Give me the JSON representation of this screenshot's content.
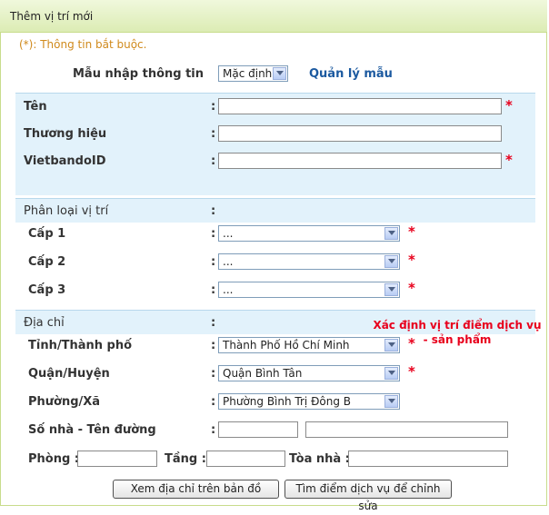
{
  "window": {
    "title": "Thêm vị trí mới"
  },
  "required_note": "(*): Thông tin bắt buộc.",
  "template": {
    "label": "Mẫu nhập thông tin",
    "selected": "Mặc định",
    "manage_link": "Quản lý mẫu"
  },
  "colon": ":",
  "star": "*",
  "fields": {
    "ten": {
      "label": "Tên",
      "value": ""
    },
    "thuong_hieu": {
      "label": "Thương hiệu",
      "value": ""
    },
    "vietbando_id": {
      "label": "VietbandoID",
      "value": ""
    }
  },
  "classification": {
    "label": "Phân loại vị trí",
    "cap1": {
      "label": "Cấp 1",
      "selected": "..."
    },
    "cap2": {
      "label": "Cấp 2",
      "selected": "..."
    },
    "cap3": {
      "label": "Cấp 3",
      "selected": "..."
    }
  },
  "address": {
    "label": "Địa chỉ",
    "locate_note": "Xác định vị trí điểm dịch vụ - sản phẩm",
    "province": {
      "label": "Tỉnh/Thành phố",
      "selected": "Thành Phố Hồ Chí Minh"
    },
    "district": {
      "label": "Quận/Huyện",
      "selected": "Quận Bình Tân"
    },
    "ward": {
      "label": "Phường/Xã",
      "selected": "Phường Bình Trị Đông B"
    },
    "street": {
      "label": "Số nhà - Tên đường",
      "number_value": "",
      "street_value": ""
    },
    "room": {
      "label": "Phòng :",
      "value": ""
    },
    "floor": {
      "label": "Tầng :",
      "value": ""
    },
    "building": {
      "label": "Tòa nhà :",
      "value": ""
    }
  },
  "buttons": {
    "view_map": "Xem địa chỉ trên bản đồ",
    "find_service": "Tìm điểm dịch vụ để chỉnh sửa"
  }
}
